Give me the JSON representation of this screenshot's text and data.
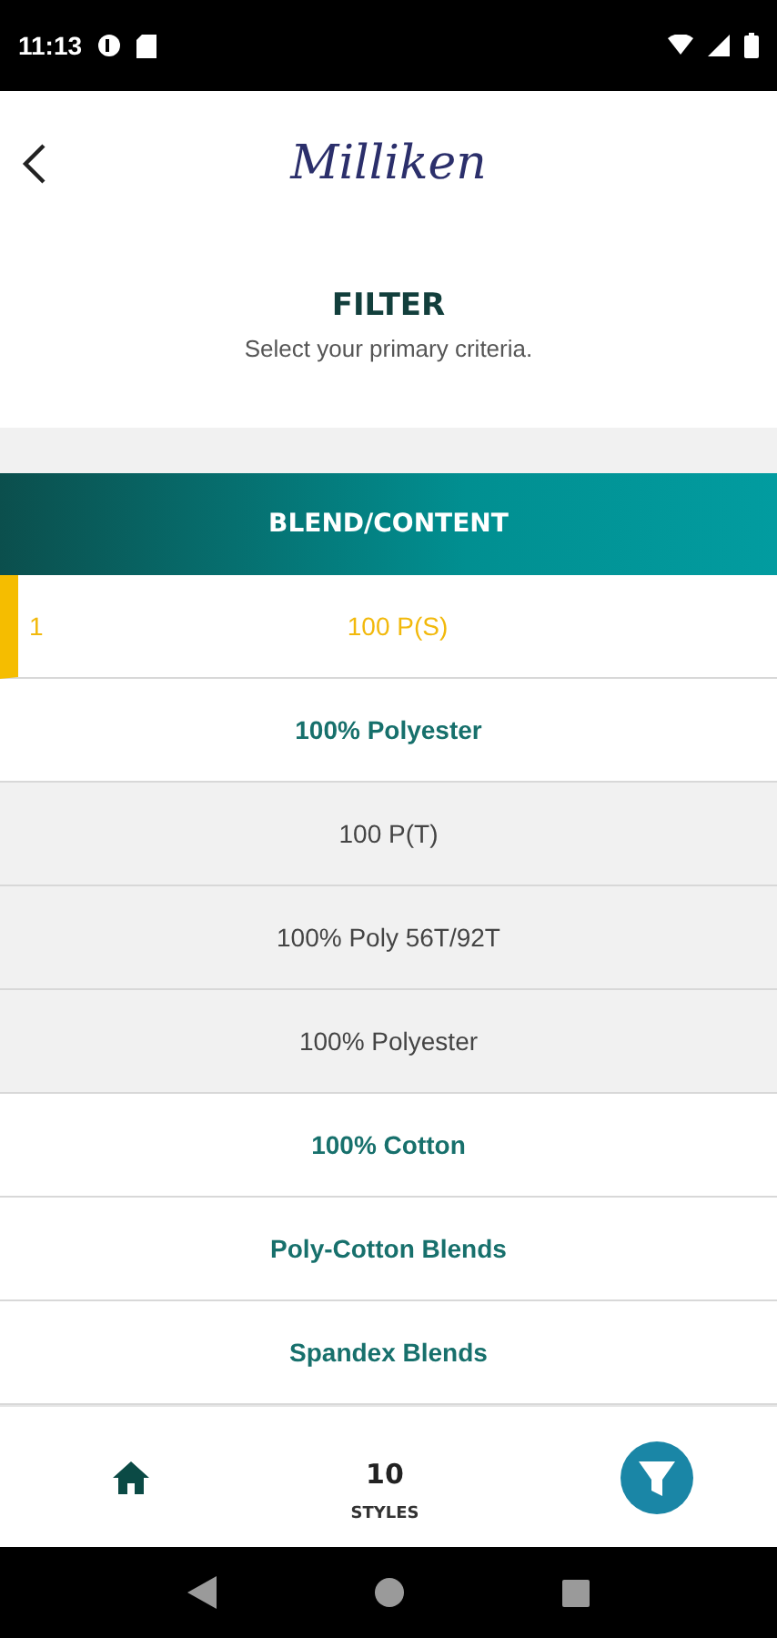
{
  "status_bar": {
    "time": "11:13"
  },
  "header": {
    "logo": "Milliken",
    "title": "FILTER",
    "subtitle": "Select your primary criteria."
  },
  "section": {
    "title": "BLEND/CONTENT"
  },
  "rows": [
    {
      "kind": "chosen",
      "number": "1",
      "label": "100 P(S)",
      "selected": true
    },
    {
      "kind": "group",
      "label": "100% Polyester",
      "selected": false
    },
    {
      "kind": "option",
      "label": "100 P(T)",
      "selected": false
    },
    {
      "kind": "option",
      "label": "100% Poly 56T/92T",
      "selected": false
    },
    {
      "kind": "option",
      "label": "100% Polyester",
      "selected": false
    },
    {
      "kind": "group",
      "label": "100% Cotton",
      "selected": false
    },
    {
      "kind": "group",
      "label": "Poly-Cotton Blends",
      "selected": false
    },
    {
      "kind": "group",
      "label": "Spandex Blends",
      "selected": false
    }
  ],
  "bottom_bar": {
    "count": "10",
    "count_label": "STYLES"
  }
}
